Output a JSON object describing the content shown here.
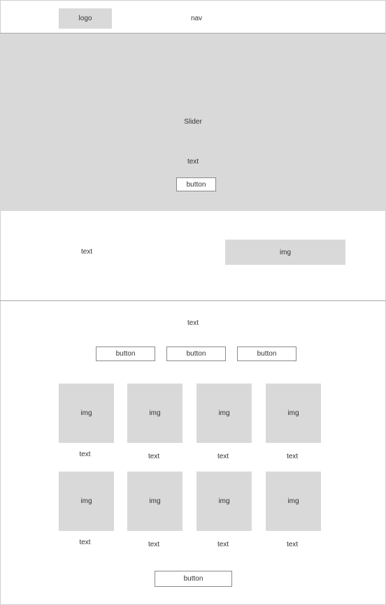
{
  "header": {
    "logo": "logo",
    "nav": "nav"
  },
  "slider": {
    "title": "Slider",
    "text": "text",
    "button": "button"
  },
  "feature": {
    "text": "text",
    "img": "img"
  },
  "products": {
    "text": "text",
    "filters": [
      "button",
      "button",
      "button"
    ],
    "rows": [
      [
        {
          "img": "img",
          "text": "text"
        },
        {
          "img": "img",
          "text": "text"
        },
        {
          "img": "img",
          "text": "text"
        },
        {
          "img": "img",
          "text": "text"
        }
      ],
      [
        {
          "img": "img",
          "text": "text"
        },
        {
          "img": "img",
          "text": "text"
        },
        {
          "img": "img",
          "text": "text"
        },
        {
          "img": "img",
          "text": "text"
        }
      ]
    ],
    "more_button": "button"
  }
}
